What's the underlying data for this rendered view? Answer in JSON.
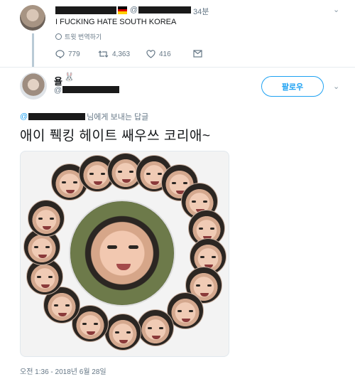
{
  "tweet1": {
    "time": "34분",
    "at_symbol": "@",
    "text": "I FUCKING HATE SOUTH KOREA",
    "translate_label": "트윗 번역하기",
    "reply_count": "779",
    "retweet_count": "4,363",
    "like_count": "416",
    "flag_colors": [
      "#000000",
      "#dd0000",
      "#ffce00"
    ]
  },
  "tweet2": {
    "name": "욜",
    "name_emoji": "🐰",
    "at_symbol": "@",
    "follow_label": "팔로우",
    "reply_prefix": "@",
    "reply_suffix": "님에게 보내는 답글",
    "text": "애이 풱킹 헤이트 쌔우쓰 코리애~",
    "timestamp": "오전 1:36 - 2018년 6월 28일"
  },
  "colors": {
    "accent": "#1da1f2",
    "muted": "#657786",
    "text": "#14171a",
    "divider": "#e6ecf0"
  },
  "icons": [
    "globe-icon",
    "reply-icon",
    "retweet-icon",
    "like-icon",
    "message-icon",
    "chevron-down-icon"
  ]
}
